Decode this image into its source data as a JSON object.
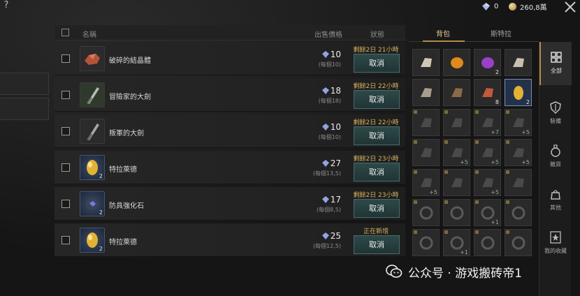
{
  "topbar": {
    "gems": "0",
    "coins": "260,8萬"
  },
  "list": {
    "header": {
      "name": "名稱",
      "price": "出售價格",
      "state": "狀態"
    },
    "rows": [
      {
        "name": "破碎的結晶體",
        "price": "10",
        "unit": "(每個10)",
        "status": "剩餘2日 21小時",
        "button": "取消",
        "icon": "crystal-shard-icon"
      },
      {
        "name": "冒險家的大劍",
        "price": "18",
        "unit": "(每個18)",
        "status": "剩餘2日 22小時",
        "button": "取消",
        "icon": "greatsword-icon"
      },
      {
        "name": "叛軍的大劍",
        "price": "10",
        "unit": "(每個10)",
        "status": "剩餘2日 22小時",
        "button": "取消",
        "icon": "greatsword-icon"
      },
      {
        "name": "特拉萊德",
        "price": "27",
        "unit": "(每個13,5)",
        "status": "剩餘2日 23小時",
        "button": "取消",
        "icon": "golden-egg-icon",
        "count": "2"
      },
      {
        "name": "防具強化石",
        "price": "17",
        "unit": "(每個8,5)",
        "status": "剩餘2日 23小時",
        "button": "取消",
        "icon": "armor-stone-icon",
        "count": "2"
      },
      {
        "name": "特拉萊德",
        "price": "25",
        "unit": "(每個12,5)",
        "status": "正在新增",
        "button": "取消",
        "icon": "golden-egg-icon",
        "count": "2"
      }
    ]
  },
  "inventory": {
    "tabs": [
      "背包",
      "斯特拉"
    ],
    "active_tab": "背包",
    "cells": [
      {
        "icon": "bone-icon",
        "count": ""
      },
      {
        "icon": "orange-bowl-icon",
        "count": ""
      },
      {
        "icon": "purple-orb-icon",
        "count": "2"
      },
      {
        "icon": "feather-icon",
        "count": ""
      },
      {
        "icon": "stone-block-icon",
        "count": ""
      },
      {
        "icon": "leather-icon",
        "count": ""
      },
      {
        "icon": "crystal-shard-icon",
        "count": "8"
      },
      {
        "icon": "golden-egg-icon",
        "count": "2",
        "selected": true
      },
      {
        "icon": "sword-icon",
        "count": ""
      },
      {
        "icon": "bow-icon",
        "count": ""
      },
      {
        "icon": "staff-icon",
        "count": "+7"
      },
      {
        "icon": "helmet-icon",
        "count": "+5"
      },
      {
        "icon": "armor-icon",
        "count": ""
      },
      {
        "icon": "chest-armor-icon",
        "count": "+5"
      },
      {
        "icon": "armor-icon",
        "count": "+5"
      },
      {
        "icon": "dagger-icon",
        "count": "+5"
      },
      {
        "icon": "blade-icon",
        "count": "+5"
      },
      {
        "icon": "gauntlet-icon",
        "count": ""
      },
      {
        "icon": "horn-icon",
        "count": "+5"
      },
      {
        "icon": "cloak-icon",
        "count": ""
      },
      {
        "icon": "necklace-icon",
        "count": ""
      },
      {
        "icon": "earring-icon",
        "count": ""
      },
      {
        "icon": "earring-icon",
        "count": "+1"
      },
      {
        "icon": "bracelet-icon",
        "count": ""
      },
      {
        "icon": "ring-icon",
        "count": ""
      },
      {
        "icon": "ring-icon",
        "count": "+1"
      },
      {
        "icon": "ring-icon",
        "count": ""
      },
      {
        "icon": "ring-icon",
        "count": ""
      }
    ]
  },
  "sidebar": {
    "items": [
      {
        "label": "全部",
        "icon": "grid-icon",
        "active": true
      },
      {
        "label": "裝備",
        "icon": "shield-icon"
      },
      {
        "label": "雜貨",
        "icon": "potion-icon"
      },
      {
        "label": "其他",
        "icon": "bag-icon"
      },
      {
        "label": "我的收藏",
        "icon": "star-icon"
      }
    ]
  },
  "watermark": {
    "text": "公众号 · 游戏搬砖帝1"
  },
  "colors": {
    "accent": "#b58a4d",
    "status": "#d8b45c",
    "button_bg": "#2e4848"
  }
}
